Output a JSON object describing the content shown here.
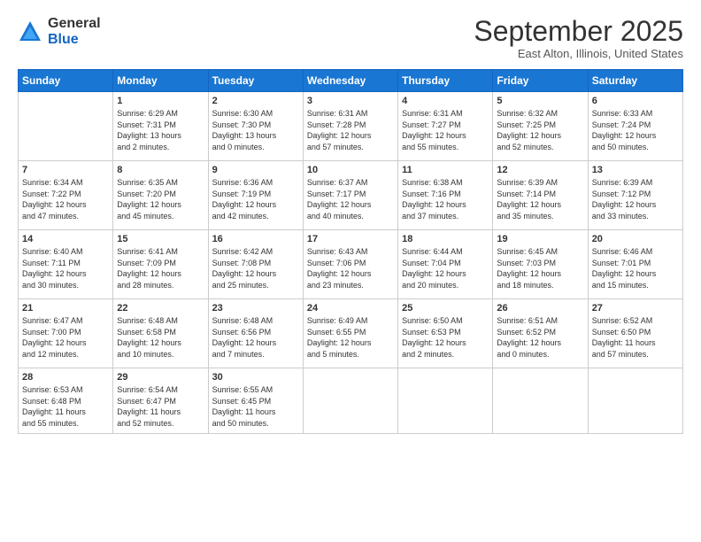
{
  "header": {
    "logo_general": "General",
    "logo_blue": "Blue",
    "month": "September 2025",
    "location": "East Alton, Illinois, United States"
  },
  "days_of_week": [
    "Sunday",
    "Monday",
    "Tuesday",
    "Wednesday",
    "Thursday",
    "Friday",
    "Saturday"
  ],
  "weeks": [
    [
      {
        "day": "",
        "info": ""
      },
      {
        "day": "1",
        "info": "Sunrise: 6:29 AM\nSunset: 7:31 PM\nDaylight: 13 hours\nand 2 minutes."
      },
      {
        "day": "2",
        "info": "Sunrise: 6:30 AM\nSunset: 7:30 PM\nDaylight: 13 hours\nand 0 minutes."
      },
      {
        "day": "3",
        "info": "Sunrise: 6:31 AM\nSunset: 7:28 PM\nDaylight: 12 hours\nand 57 minutes."
      },
      {
        "day": "4",
        "info": "Sunrise: 6:31 AM\nSunset: 7:27 PM\nDaylight: 12 hours\nand 55 minutes."
      },
      {
        "day": "5",
        "info": "Sunrise: 6:32 AM\nSunset: 7:25 PM\nDaylight: 12 hours\nand 52 minutes."
      },
      {
        "day": "6",
        "info": "Sunrise: 6:33 AM\nSunset: 7:24 PM\nDaylight: 12 hours\nand 50 minutes."
      }
    ],
    [
      {
        "day": "7",
        "info": "Sunrise: 6:34 AM\nSunset: 7:22 PM\nDaylight: 12 hours\nand 47 minutes."
      },
      {
        "day": "8",
        "info": "Sunrise: 6:35 AM\nSunset: 7:20 PM\nDaylight: 12 hours\nand 45 minutes."
      },
      {
        "day": "9",
        "info": "Sunrise: 6:36 AM\nSunset: 7:19 PM\nDaylight: 12 hours\nand 42 minutes."
      },
      {
        "day": "10",
        "info": "Sunrise: 6:37 AM\nSunset: 7:17 PM\nDaylight: 12 hours\nand 40 minutes."
      },
      {
        "day": "11",
        "info": "Sunrise: 6:38 AM\nSunset: 7:16 PM\nDaylight: 12 hours\nand 37 minutes."
      },
      {
        "day": "12",
        "info": "Sunrise: 6:39 AM\nSunset: 7:14 PM\nDaylight: 12 hours\nand 35 minutes."
      },
      {
        "day": "13",
        "info": "Sunrise: 6:39 AM\nSunset: 7:12 PM\nDaylight: 12 hours\nand 33 minutes."
      }
    ],
    [
      {
        "day": "14",
        "info": "Sunrise: 6:40 AM\nSunset: 7:11 PM\nDaylight: 12 hours\nand 30 minutes."
      },
      {
        "day": "15",
        "info": "Sunrise: 6:41 AM\nSunset: 7:09 PM\nDaylight: 12 hours\nand 28 minutes."
      },
      {
        "day": "16",
        "info": "Sunrise: 6:42 AM\nSunset: 7:08 PM\nDaylight: 12 hours\nand 25 minutes."
      },
      {
        "day": "17",
        "info": "Sunrise: 6:43 AM\nSunset: 7:06 PM\nDaylight: 12 hours\nand 23 minutes."
      },
      {
        "day": "18",
        "info": "Sunrise: 6:44 AM\nSunset: 7:04 PM\nDaylight: 12 hours\nand 20 minutes."
      },
      {
        "day": "19",
        "info": "Sunrise: 6:45 AM\nSunset: 7:03 PM\nDaylight: 12 hours\nand 18 minutes."
      },
      {
        "day": "20",
        "info": "Sunrise: 6:46 AM\nSunset: 7:01 PM\nDaylight: 12 hours\nand 15 minutes."
      }
    ],
    [
      {
        "day": "21",
        "info": "Sunrise: 6:47 AM\nSunset: 7:00 PM\nDaylight: 12 hours\nand 12 minutes."
      },
      {
        "day": "22",
        "info": "Sunrise: 6:48 AM\nSunset: 6:58 PM\nDaylight: 12 hours\nand 10 minutes."
      },
      {
        "day": "23",
        "info": "Sunrise: 6:48 AM\nSunset: 6:56 PM\nDaylight: 12 hours\nand 7 minutes."
      },
      {
        "day": "24",
        "info": "Sunrise: 6:49 AM\nSunset: 6:55 PM\nDaylight: 12 hours\nand 5 minutes."
      },
      {
        "day": "25",
        "info": "Sunrise: 6:50 AM\nSunset: 6:53 PM\nDaylight: 12 hours\nand 2 minutes."
      },
      {
        "day": "26",
        "info": "Sunrise: 6:51 AM\nSunset: 6:52 PM\nDaylight: 12 hours\nand 0 minutes."
      },
      {
        "day": "27",
        "info": "Sunrise: 6:52 AM\nSunset: 6:50 PM\nDaylight: 11 hours\nand 57 minutes."
      }
    ],
    [
      {
        "day": "28",
        "info": "Sunrise: 6:53 AM\nSunset: 6:48 PM\nDaylight: 11 hours\nand 55 minutes."
      },
      {
        "day": "29",
        "info": "Sunrise: 6:54 AM\nSunset: 6:47 PM\nDaylight: 11 hours\nand 52 minutes."
      },
      {
        "day": "30",
        "info": "Sunrise: 6:55 AM\nSunset: 6:45 PM\nDaylight: 11 hours\nand 50 minutes."
      },
      {
        "day": "",
        "info": ""
      },
      {
        "day": "",
        "info": ""
      },
      {
        "day": "",
        "info": ""
      },
      {
        "day": "",
        "info": ""
      }
    ]
  ]
}
